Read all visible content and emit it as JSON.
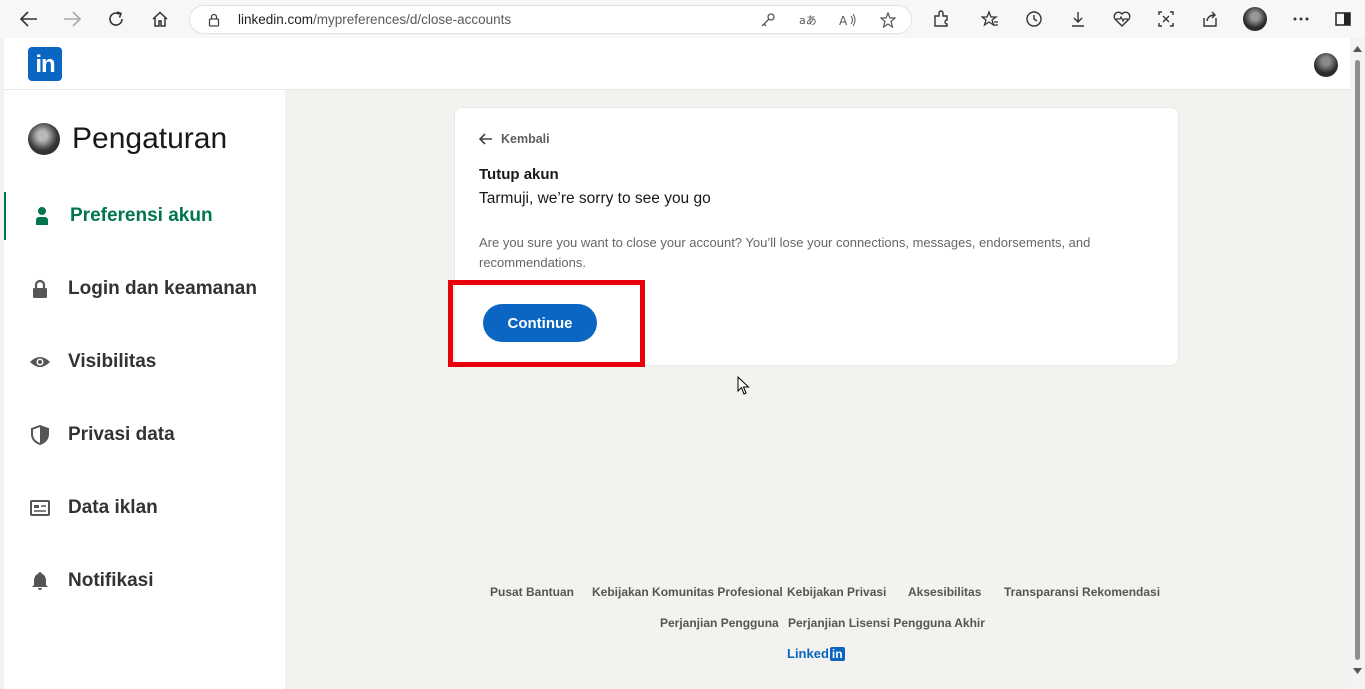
{
  "browser": {
    "url_host": "linkedin.com",
    "url_path": "/mypreferences/d/close-accounts"
  },
  "header": {
    "logo_text": "in"
  },
  "sidebar": {
    "title": "Pengaturan",
    "items": [
      {
        "label": "Preferensi akun",
        "icon": "person-icon",
        "active": true
      },
      {
        "label": "Login dan keamanan",
        "icon": "lock-icon",
        "active": false
      },
      {
        "label": "Visibilitas",
        "icon": "eye-icon",
        "active": false
      },
      {
        "label": "Privasi data",
        "icon": "shield-icon",
        "active": false
      },
      {
        "label": "Data iklan",
        "icon": "ad-icon",
        "active": false
      },
      {
        "label": "Notifikasi",
        "icon": "bell-icon",
        "active": false
      }
    ]
  },
  "card": {
    "back_label": "Kembali",
    "title": "Tutup akun",
    "subtitle": "Tarmuji, we’re sorry to see you go",
    "description": "Are you sure you want to close your account? You’ll lose your connections, messages, endorsements, and recommendations.",
    "continue_label": "Continue"
  },
  "footer": {
    "row1": [
      "Pusat Bantuan",
      "Kebijakan Komunitas Profesional",
      "Kebijakan Privasi",
      "Aksesibilitas",
      "Transparansi Rekomendasi"
    ],
    "row2": [
      "Perjanjian Pengguna",
      "Perjanjian Lisensi Pengguna Akhir"
    ],
    "logo_text": "Linked",
    "logo_in": "in"
  },
  "colors": {
    "linkedin_blue": "#0a66c2",
    "active_green": "#01754f",
    "highlight_red": "#e8000b"
  }
}
